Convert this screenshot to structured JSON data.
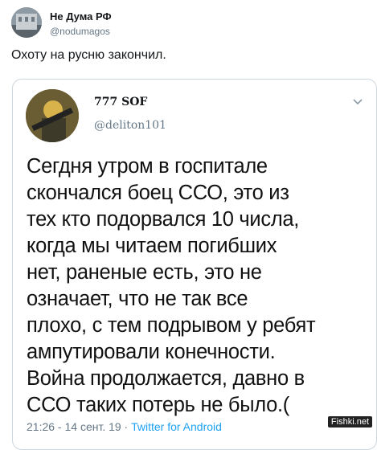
{
  "tweet": {
    "author_name": "Не Дума РФ",
    "author_handle": "@nodumagos",
    "text": "Охоту на русню закончил."
  },
  "quoted": {
    "author_name": "777 SOF",
    "author_handle": "@deliton101",
    "text": "Сегдня утром в госпитале\nскончался боец ССО, это из\nтех кто подорвался 10 числа,\nкогда мы читаем погибших\nнет, раненые есть, это не\nозначает, что не так все\nплохо, с тем подрывом у ребят\nампутировали конечности.\nВойна продолжается, давно в\nССО таких потерь не было.(",
    "footer_time": "21:26 - 14 сент. 19 ·",
    "footer_source": "Twitter for Android"
  },
  "icons": {
    "more": "chevron-down-icon"
  },
  "watermark": "Fishki.net",
  "colors": {
    "link": "#1da1f2",
    "muted": "#657786",
    "border": "#ccd6dd"
  }
}
